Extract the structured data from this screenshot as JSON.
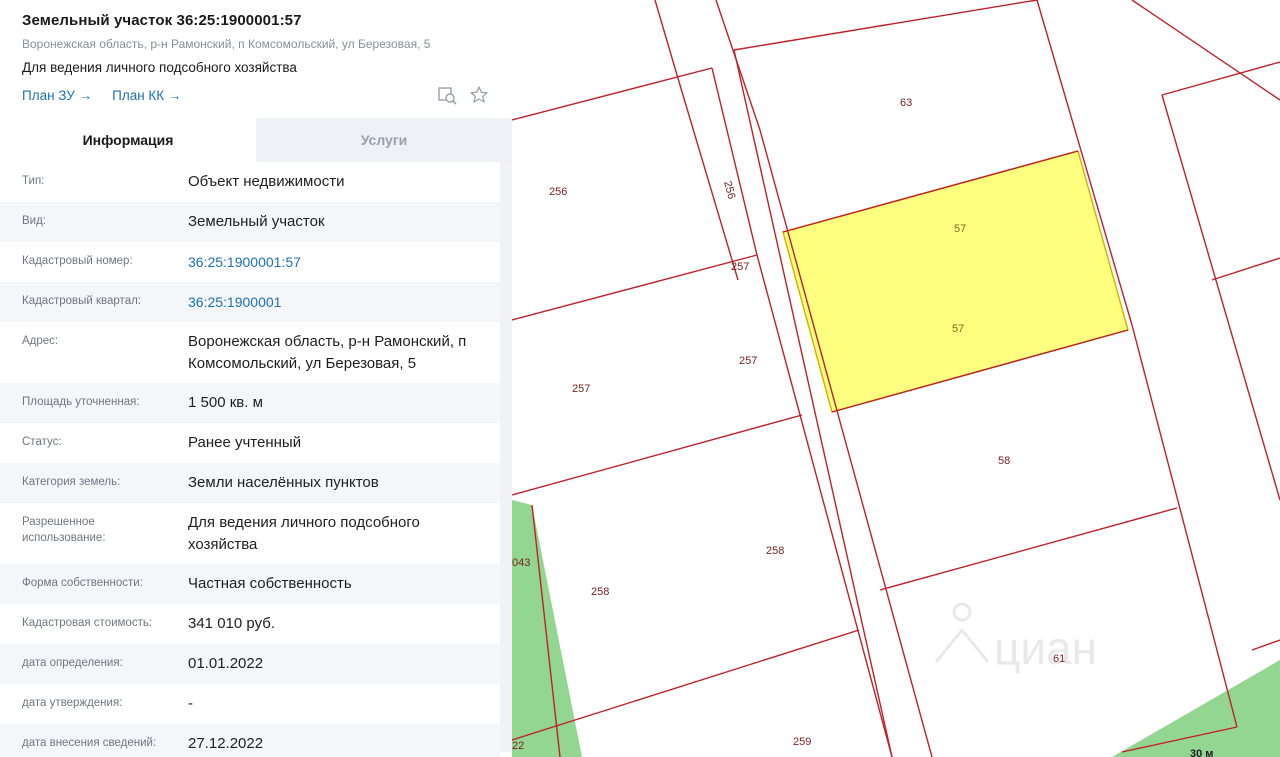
{
  "panel": {
    "title": "Земельный участок 36:25:1900001:57",
    "address": "Воронежская область, р-н Рамонский, п Комсомольский, ул Березовая, 5",
    "purpose": "Для ведения личного подсобного хозяйства",
    "links": {
      "plan_zu": "План ЗУ →",
      "plan_kk": "План КК →"
    },
    "icons": {
      "inspect": "inspect-icon",
      "favorite": "star-icon"
    },
    "tabs": [
      {
        "label": "Информация",
        "active": true
      },
      {
        "label": "Услуги",
        "active": false
      }
    ],
    "rows": [
      {
        "label": "Тип:",
        "value": "Объект недвижимости"
      },
      {
        "label": "Вид:",
        "value": "Земельный участок"
      },
      {
        "label": "Кадастровый номер:",
        "value": "36:25:1900001:57"
      },
      {
        "label": "Кадастровый квартал:",
        "value": "36:25:1900001"
      },
      {
        "label": "Адрес:",
        "value": "Воронежская область, р-н Рамонский, п Комсомольский, ул Березовая, 5"
      },
      {
        "label": "Площадь уточненная:",
        "value": "1 500 кв. м"
      },
      {
        "label": "Статус:",
        "value": "Ранее учтенный"
      },
      {
        "label": "Категория земель:",
        "value": "Земли населённых пунктов"
      },
      {
        "label": "Разрешенное использование:",
        "value": "Для ведения личного подсобного хозяйства"
      },
      {
        "label": "Форма собственности:",
        "value": "Частная собственность"
      },
      {
        "label": "Кадастровая стоимость:",
        "value": "341 010 руб."
      },
      {
        "label": "дата определения:",
        "value": "01.01.2022"
      },
      {
        "label": "дата утверждения:",
        "value": "-"
      },
      {
        "label": "дата внесения сведений:",
        "value": "27.12.2022"
      }
    ]
  },
  "map": {
    "colors": {
      "boundary": "#c0202a",
      "selected_fill": "#ffff80",
      "greenery": "#7fcf7f"
    },
    "labels": [
      "63",
      "256",
      "256",
      "257",
      "257",
      "257",
      "57",
      "57",
      "58",
      "258",
      "258",
      "043",
      "61",
      "259",
      "22",
      "30 м"
    ],
    "watermark": "циан"
  }
}
